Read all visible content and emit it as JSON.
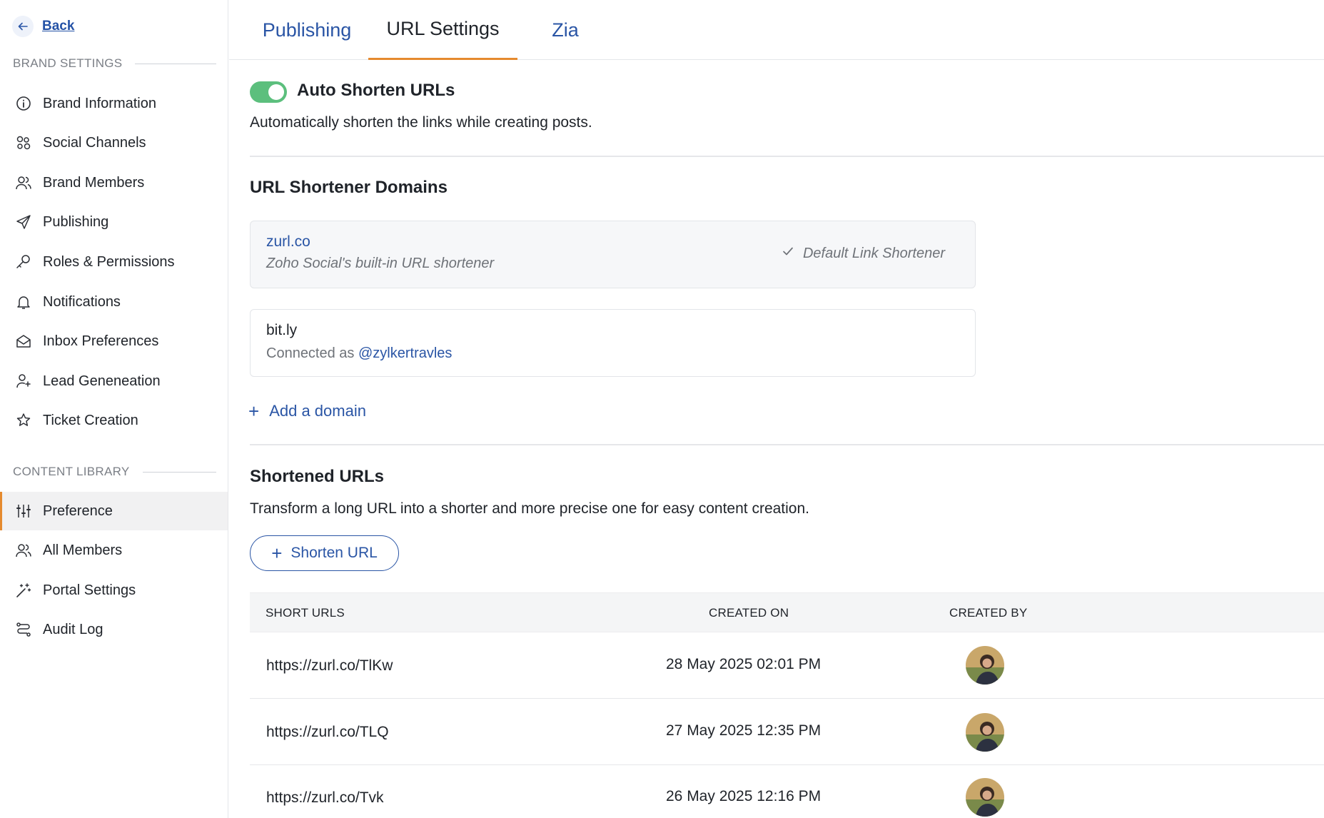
{
  "sidebar": {
    "back_label": "Back",
    "brand_settings_heading": "BRAND SETTINGS",
    "brand_items": [
      {
        "label": "Brand Information",
        "icon": "info-icon"
      },
      {
        "label": "Social Channels",
        "icon": "social-channels-icon"
      },
      {
        "label": "Brand Members",
        "icon": "members-icon"
      },
      {
        "label": "Publishing",
        "icon": "paper-plane-icon"
      },
      {
        "label": "Roles & Permissions",
        "icon": "key-icon"
      },
      {
        "label": "Notifications",
        "icon": "bell-icon"
      },
      {
        "label": "Inbox Preferences",
        "icon": "envelope-open-icon"
      },
      {
        "label": "Lead Geneneation",
        "icon": "lead-icon"
      },
      {
        "label": "Ticket Creation",
        "icon": "ticket-star-icon"
      }
    ],
    "content_library_heading": "CONTENT LIBRARY",
    "library_items": [
      {
        "label": "Preference",
        "icon": "sliders-icon",
        "active": true
      },
      {
        "label": "All Members",
        "icon": "members-icon"
      },
      {
        "label": "Portal Settings",
        "icon": "magic-wand-icon"
      },
      {
        "label": "Audit Log",
        "icon": "route-icon"
      }
    ]
  },
  "tabs": [
    {
      "label": "Publishing",
      "active": false
    },
    {
      "label": "URL Settings",
      "active": true
    },
    {
      "label": "Zia",
      "active": false
    }
  ],
  "auto_shorten": {
    "title": "Auto Shorten URLs",
    "enabled": true,
    "description": "Automatically shorten the links while creating posts."
  },
  "domains": {
    "heading": "URL Shortener Domains",
    "default_domain": {
      "name": "zurl.co",
      "subtitle": "Zoho Social's built-in URL shortener",
      "badge": "Default Link Shortener"
    },
    "bitly": {
      "name": "bit.ly",
      "connected_prefix": "Connected as",
      "handle": "@zylkertravles"
    },
    "add_label": "Add a domain"
  },
  "shortened": {
    "heading": "Shortened URLs",
    "description": "Transform a long URL into a shorter and more precise one for easy content creation.",
    "button_label": "Shorten URL",
    "columns": [
      "SHORT URLS",
      "CREATED ON",
      "CREATED BY"
    ],
    "rows": [
      {
        "url": "https://zurl.co/TlKw",
        "created_on": "28 May 2025 02:01 PM"
      },
      {
        "url": "https://zurl.co/TLQ",
        "created_on": "27 May 2025 12:35 PM"
      },
      {
        "url": "https://zurl.co/Tvk",
        "created_on": "26 May 2025 12:16 PM"
      }
    ]
  },
  "colors": {
    "accent_orange": "#e58a2e",
    "link_blue": "#2a55a5",
    "toggle_green": "#5cbf7d"
  }
}
